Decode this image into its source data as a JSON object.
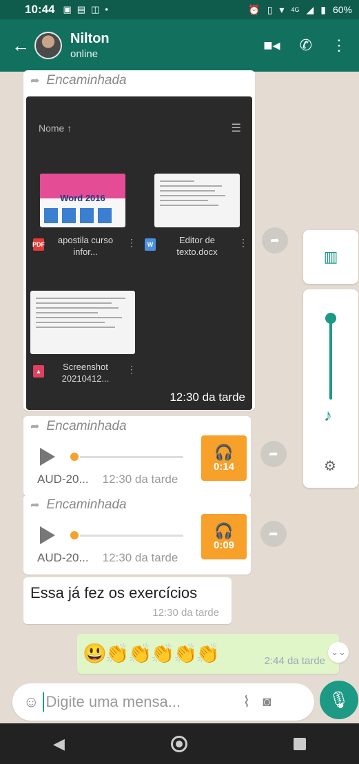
{
  "status_bar": {
    "time": "10:44",
    "battery": "60%",
    "network": "4G"
  },
  "header": {
    "back_icon": "arrow-left-icon",
    "contact_name": "Nilton",
    "presence": "online",
    "video_icon": "video-call-icon",
    "phone_icon": "phone-icon",
    "menu_icon": "more-vert-icon"
  },
  "messages": {
    "forwarded_label": "Encaminhada",
    "doc_panel": {
      "sort_label": "Nome ↑",
      "word_thumb_title": "Word 2016",
      "files": [
        {
          "name": "apostila curso infor...",
          "type": "PDF"
        },
        {
          "name": "Editor de texto.docx",
          "type": "W"
        },
        {
          "name": "Screenshot 20210412...",
          "type": "IMG"
        }
      ],
      "time": "12:30 da tarde"
    },
    "audios": [
      {
        "name": "AUD-20...",
        "time": "12:30 da tarde",
        "duration": "0:14"
      },
      {
        "name": "AUD-20...",
        "time": "12:30 da tarde",
        "duration": "0:09"
      }
    ],
    "text_message": {
      "text": "Essa já fez os exercícios",
      "time": "12:30 da tarde"
    },
    "outgoing": {
      "emojis": "😃👏👏👏👏👏",
      "time": "2:44 da tarde"
    }
  },
  "volume_panel": {
    "level": 0.92,
    "accent": "#1d9a86"
  },
  "composer": {
    "placeholder": "Digite uma mensa..."
  },
  "colors": {
    "app_bar": "#12705f",
    "accent": "#1d9a86",
    "audio_thumb": "#f7a02a",
    "outgoing_bubble": "#e0f6c8"
  }
}
